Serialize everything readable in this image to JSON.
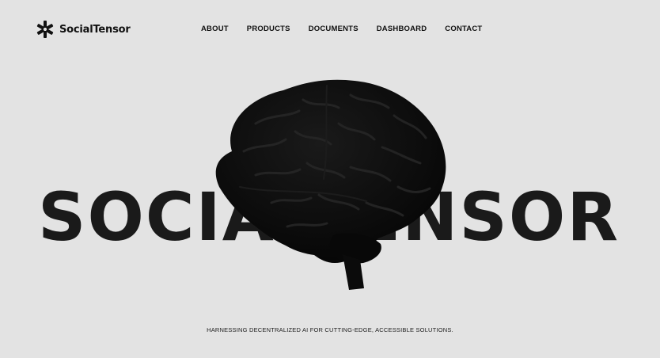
{
  "brand": {
    "name": "SocialTensor",
    "logo_icon": "asterisk-logo-icon"
  },
  "nav": {
    "items": [
      {
        "label": "ABOUT"
      },
      {
        "label": "PRODUCTS"
      },
      {
        "label": "DOCUMENTS"
      },
      {
        "label": "DASHBOARD"
      },
      {
        "label": "CONTACT"
      }
    ]
  },
  "hero": {
    "word": "SOCIALTENSOR",
    "image": "brain-image",
    "tagline": "HARNESSING DECENTRALIZED AI FOR CUTTING-EDGE, ACCESSIBLE SOLUTIONS."
  },
  "colors": {
    "background": "#e3e3e3",
    "text": "#121212",
    "brain": "#0d0d0d"
  }
}
